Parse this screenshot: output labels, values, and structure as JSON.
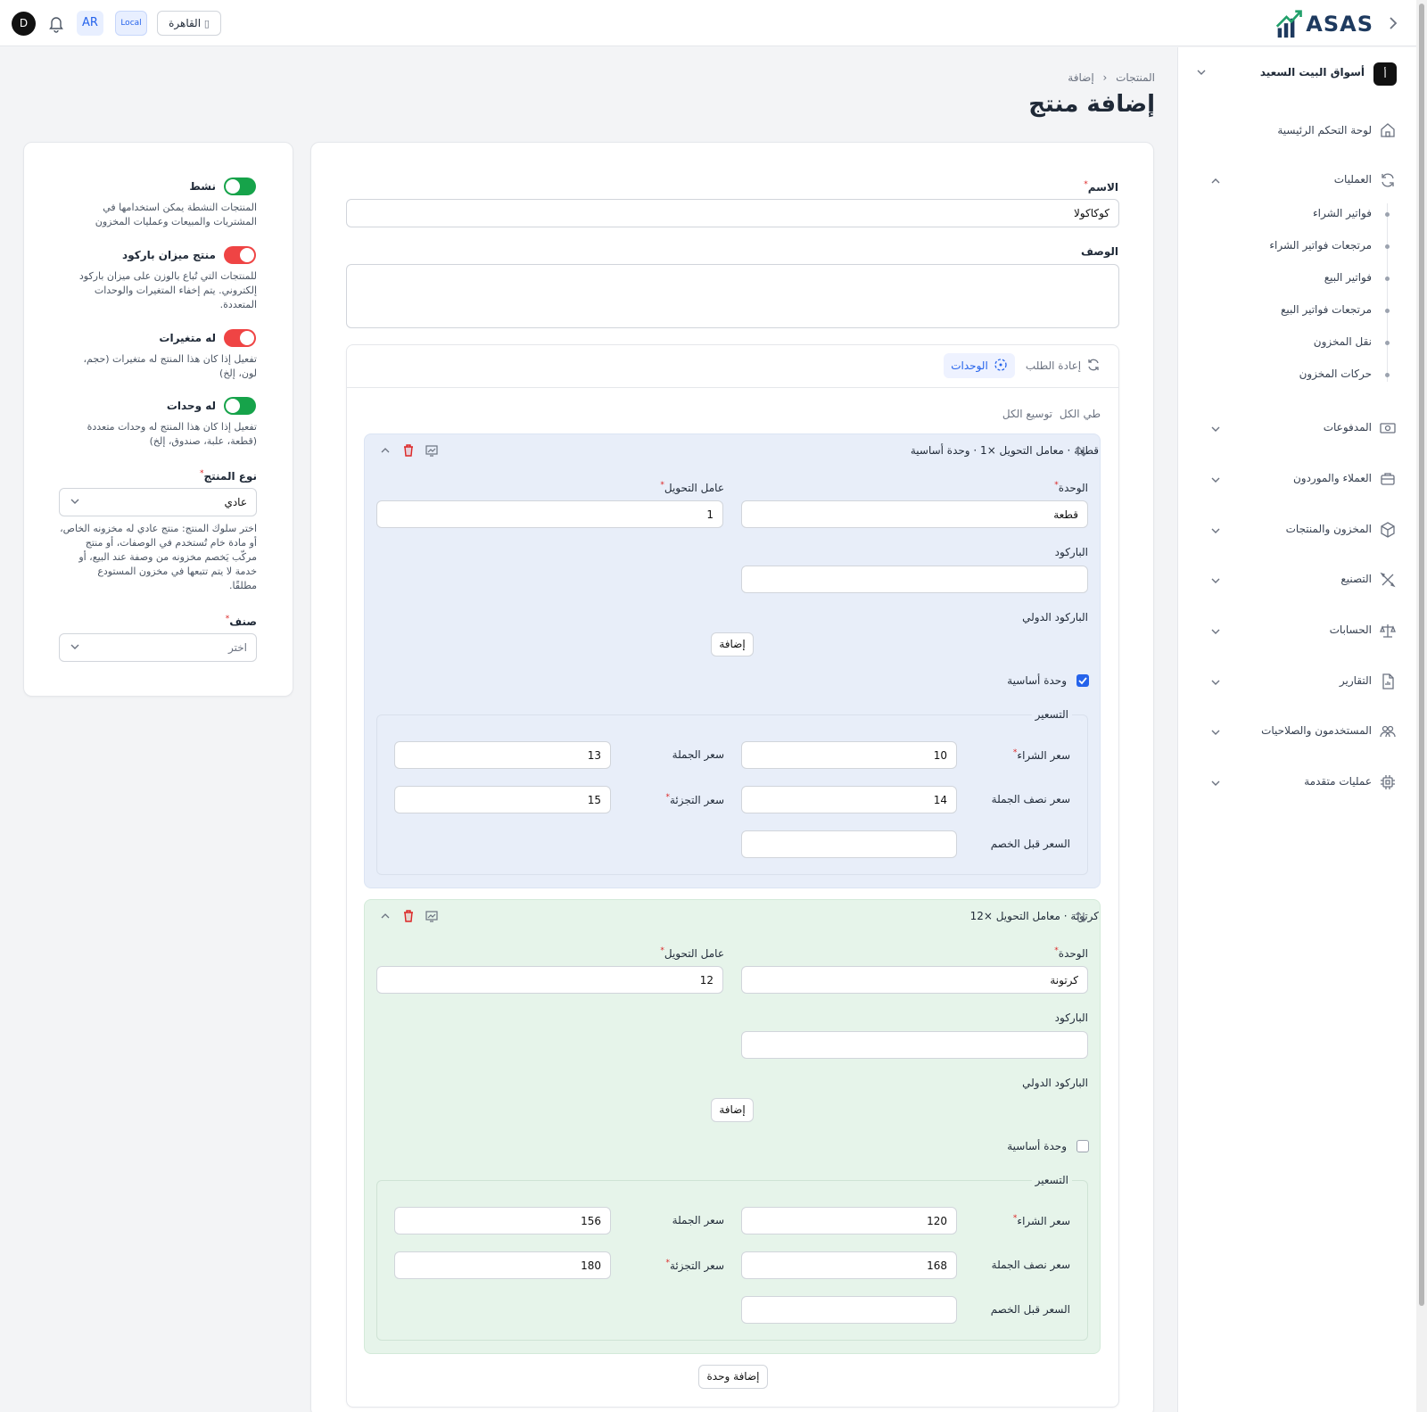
{
  "topbar": {
    "logo_text": "ASAS",
    "avatar_initial": "D",
    "lang": "AR",
    "env": "Local",
    "branch": "القاهرة"
  },
  "sidebar": {
    "store_initial": "أ",
    "store_name": "أسواق البيت السعيد",
    "items": [
      {
        "label": "لوحة التحكم الرئيسية",
        "icon": "home-icon"
      },
      {
        "label": "العمليات",
        "icon": "refresh-icon",
        "expanded": true,
        "children": [
          "فواتير الشراء",
          "مرتجعات فواتير الشراء",
          "فواتير البيع",
          "مرتجعات فواتير البيع",
          "نقل المخزون",
          "حركات المخزون"
        ]
      },
      {
        "label": "المدفوعات",
        "icon": "payments-icon"
      },
      {
        "label": "العملاء والموردون",
        "icon": "briefcase-icon"
      },
      {
        "label": "المخزون والمنتجات",
        "icon": "box-icon"
      },
      {
        "label": "التصنيع",
        "icon": "tools-icon"
      },
      {
        "label": "الحسابات",
        "icon": "scale-icon"
      },
      {
        "label": "التقارير",
        "icon": "report-icon"
      },
      {
        "label": "المستخدمون والصلاحيات",
        "icon": "users-icon"
      },
      {
        "label": "عمليات متقدمة",
        "icon": "cpu-icon"
      }
    ]
  },
  "breadcrumb": {
    "root": "المنتجات",
    "current": "إضافة"
  },
  "page_title": "إضافة منتج",
  "form": {
    "name_label": "الاسم",
    "name_value": "كوكاكولا",
    "desc_label": "الوصف",
    "desc_value": "",
    "tabs": {
      "units": "الوحدات",
      "reorder": "إعادة الطلب"
    },
    "collapse_all": "طي الكل",
    "expand_all": "توسيع الكل",
    "add_unit": "إضافة وحدة",
    "labels": {
      "unit": "الوحدة",
      "factor": "عامل التحويل",
      "barcode": "الباركود",
      "intl_barcode": "الباركود الدولي",
      "add": "إضافة",
      "base_unit": "وحدة أساسية",
      "pricing": "التسعير",
      "purchase": "سعر الشراء",
      "wholesale": "سعر الجملة",
      "semi": "سعر نصف الجملة",
      "retail": "سعر التجزئة",
      "before_discount": "السعر قبل الخصم"
    },
    "units": [
      {
        "header": "قطعة · معامل التحويل ×1 · وحدة أساسية",
        "unit": "قطعة",
        "factor": "1",
        "barcode": "",
        "base": true,
        "purchase": "10",
        "wholesale": "13",
        "semi": "14",
        "retail": "15",
        "before_discount": "",
        "color": "#e8eef9"
      },
      {
        "header": "كرتونة · معامل التحويل ×12",
        "unit": "كرتونة",
        "factor": "12",
        "barcode": "",
        "base": false,
        "purchase": "120",
        "wholesale": "156",
        "semi": "168",
        "retail": "180",
        "before_discount": "",
        "color": "#e6f4ea"
      }
    ]
  },
  "side_panel": {
    "active": {
      "title": "نشط",
      "desc1": "المنتجات النشطة يمكن استخدامها في",
      "desc2": "المشتريات والمبيعات وعمليات المخزون",
      "on": true,
      "color": "#16a34a"
    },
    "scale": {
      "title": "منتج ميزان باركود",
      "desc1": "للمنتجات التي تُباع بالوزن على ميزان باركود",
      "desc2": "إلكتروني. يتم إخفاء المتغيرات والوحدات",
      "desc3": "المتعددة.",
      "on": true,
      "color": "#ef4444"
    },
    "variants": {
      "title": "له متغيرات",
      "desc1": "تفعيل إذا كان هذا المنتج له متغيرات (حجم،",
      "desc2": "لون، إلخ)",
      "on": true,
      "color": "#ef4444"
    },
    "has_units": {
      "title": "له وحدات",
      "desc1": "تفعيل إذا كان هذا المنتج له وحدات متعددة",
      "desc2": "(قطعة، علبة، صندوق، إلخ)",
      "on": true,
      "color": "#16a34a"
    },
    "type_label": "نوع المنتج",
    "type_value": "عادي",
    "type_help": [
      "اختر سلوك المنتج: منتج عادي له مخزونه الخاص،",
      "أو مادة خام تُستخدم في الوصفات، أو منتج",
      "مركّب يَخصم مخزونه من وصفة عند البيع، أو",
      "خدمة لا يتم تتبعها في مخزون المستودع",
      "مطلقًا."
    ],
    "category_label": "صنف",
    "category_placeholder": "اختر"
  }
}
